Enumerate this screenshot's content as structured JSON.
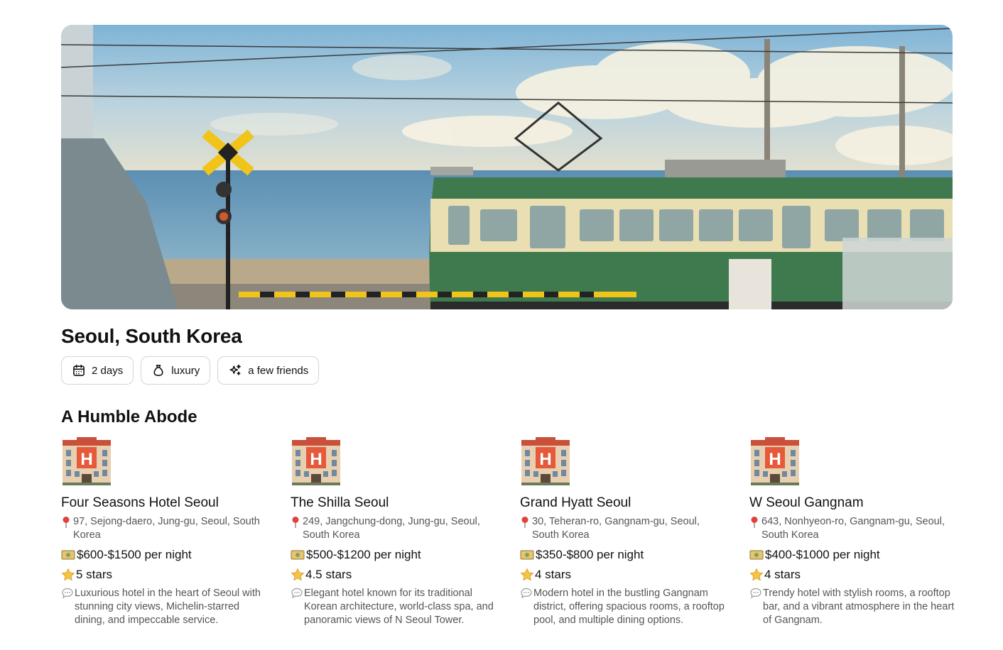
{
  "hero": {
    "image": "seaside-tram-railway-crossing"
  },
  "trip": {
    "title": "Seoul, South Korea",
    "chips": [
      {
        "icon": "calendar-icon",
        "label": "2 days"
      },
      {
        "icon": "money-bag-icon",
        "label": "luxury"
      },
      {
        "icon": "sparkles-icon",
        "label": "a few friends"
      }
    ]
  },
  "accommodation": {
    "title": "A Humble Abode",
    "hotels": [
      {
        "icon": "hotel-icon",
        "name": "Four Seasons Hotel Seoul",
        "address": "97, Sejong-daero, Jung-gu, Seoul, South Korea",
        "price": "$600-$1500 per night",
        "rating": "5 stars",
        "description": "Luxurious hotel in the heart of Seoul with stunning city views, Michelin-starred dining, and impeccable service."
      },
      {
        "icon": "hotel-icon",
        "name": "The Shilla Seoul",
        "address": "249, Jangchung-dong, Jung-gu, Seoul, South Korea",
        "price": "$500-$1200 per night",
        "rating": "4.5 stars",
        "description": "Elegant hotel known for its traditional Korean architecture, world-class spa, and panoramic views of N Seoul Tower."
      },
      {
        "icon": "hotel-icon",
        "name": "Grand Hyatt Seoul",
        "address": "30, Teheran-ro, Gangnam-gu, Seoul, South Korea",
        "price": "$350-$800 per night",
        "rating": "4 stars",
        "description": "Modern hotel in the bustling Gangnam district, offering spacious rooms, a rooftop pool, and multiple dining options."
      },
      {
        "icon": "hotel-icon",
        "name": "W Seoul Gangnam",
        "address": "643, Nonhyeon-ro, Gangnam-gu, Seoul, South Korea",
        "price": "$400-$1000 per night",
        "rating": "4 stars",
        "description": "Trendy hotel with stylish rooms, a rooftop bar, and a vibrant atmosphere in the heart of Gangnam."
      }
    ]
  },
  "colors": {
    "text": "#111111",
    "muted": "#555555",
    "chip_border": "#d4d4d4",
    "tram_green": "#3f7a4e",
    "tram_cream": "#e9dfb2"
  }
}
